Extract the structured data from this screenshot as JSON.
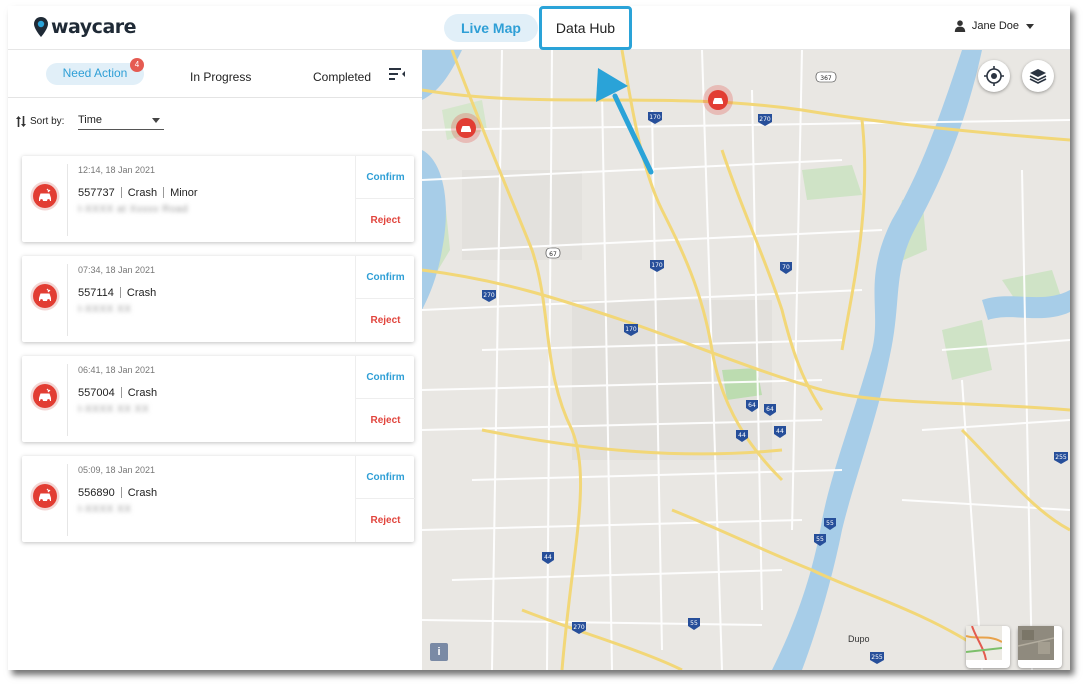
{
  "header": {
    "logo_text": "waycare",
    "nav_live_map": "Live Map",
    "nav_data_hub": "Data Hub",
    "user_name": "Jane Doe"
  },
  "tabs": {
    "need_action": "Need Action",
    "need_action_count": "4",
    "in_progress": "In Progress",
    "completed": "Completed"
  },
  "sort": {
    "label": "Sort by:",
    "value": "Time"
  },
  "incidents": [
    {
      "time": "12:14, 18 Jan 2021",
      "id": "557737",
      "type": "Crash",
      "severity": "Minor",
      "address": "I-XXXX at Xxxxx Road",
      "confirm": "Confirm",
      "reject": "Reject"
    },
    {
      "time": "07:34, 18 Jan 2021",
      "id": "557114",
      "type": "Crash",
      "severity": "",
      "address": "I-XXXX XX",
      "confirm": "Confirm",
      "reject": "Reject"
    },
    {
      "time": "06:41, 18 Jan 2021",
      "id": "557004",
      "type": "Crash",
      "severity": "",
      "address": "I-XXXX XX XX",
      "confirm": "Confirm",
      "reject": "Reject"
    },
    {
      "time": "05:09, 18 Jan 2021",
      "id": "556890",
      "type": "Crash",
      "severity": "",
      "address": "I-XXXX XX",
      "confirm": "Confirm",
      "reject": "Reject"
    }
  ],
  "map": {
    "info_label": "i",
    "place_label": "Dupo",
    "shields": [
      "367",
      "170",
      "270",
      "67",
      "170",
      "70",
      "270",
      "170",
      "64",
      "64",
      "44",
      "44",
      "255",
      "55",
      "55",
      "44",
      "270",
      "55",
      "255"
    ]
  },
  "colors": {
    "accent": "#2f9fd6",
    "reject": "#e1443c",
    "incident": "#e23d33",
    "annotation": "#2aa3d8"
  }
}
